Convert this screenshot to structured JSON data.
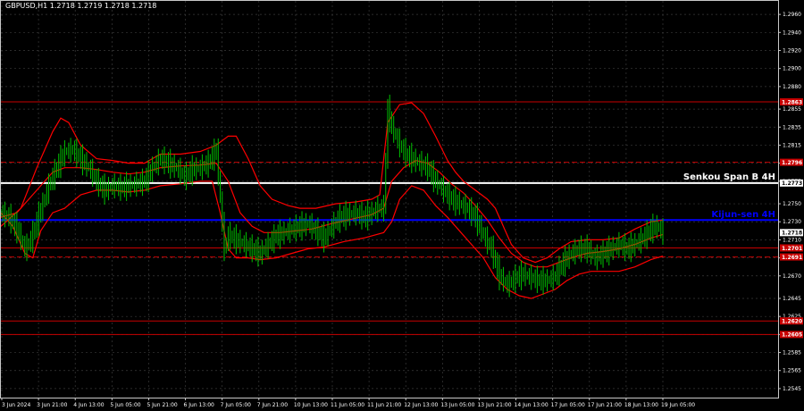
{
  "symbol_info": "GBPUSD,H1  1.2718 1.2719 1.2718 1.2718",
  "colors": {
    "background": "#000000",
    "grid": "#3a3a3a",
    "frame": "#c8c8c8",
    "candle": "#00c000",
    "indicator": "#ff0000",
    "level_line": "#c80000",
    "senkou_line": "#ffffff",
    "kijun_line": "#0000ff",
    "text": "#ffffff"
  },
  "chart_data": {
    "type": "line",
    "title": "GBPUSD,H1  1.2718 1.2719 1.2718 1.2718",
    "ylim": [
      1.2535,
      1.2975
    ],
    "y_ticks": [
      "1.2960",
      "1.2940",
      "1.2920",
      "1.2900",
      "1.2880",
      "1.2855",
      "1.2835",
      "1.2815",
      "1.2795",
      "1.2775",
      "1.2750",
      "1.2730",
      "1.2710",
      "1.2690",
      "1.2670",
      "1.2645",
      "1.2625",
      "1.2605",
      "1.2585",
      "1.2565",
      "1.2545"
    ],
    "x_ticks": [
      "3 Jun 2024",
      "3 Jun 21:00",
      "4 Jun 13:00",
      "5 Jun 05:00",
      "5 Jun 21:00",
      "6 Jun 13:00",
      "7 Jun 05:00",
      "7 Jun 21:00",
      "10 Jun 13:00",
      "11 Jun 05:00",
      "11 Jun 21:00",
      "12 Jun 13:00",
      "13 Jun 05:00",
      "13 Jun 21:00",
      "14 Jun 13:00",
      "17 Jun 05:00",
      "17 Jun 21:00",
      "18 Jun 13:00",
      "19 Jun 05:00"
    ],
    "price_path": [
      [
        0,
        1.274
      ],
      [
        4,
        1.2735
      ],
      [
        8,
        1.2722
      ],
      [
        12,
        1.27
      ],
      [
        15,
        1.271
      ],
      [
        18,
        1.273
      ],
      [
        21,
        1.275
      ],
      [
        24,
        1.277
      ],
      [
        28,
        1.279
      ],
      [
        32,
        1.2808
      ],
      [
        36,
        1.281
      ],
      [
        40,
        1.28
      ],
      [
        44,
        1.279
      ],
      [
        48,
        1.2775
      ],
      [
        52,
        1.2765
      ],
      [
        56,
        1.277
      ],
      [
        60,
        1.2768
      ],
      [
        64,
        1.277
      ],
      [
        68,
        1.2772
      ],
      [
        72,
        1.2775
      ],
      [
        76,
        1.279
      ],
      [
        80,
        1.28
      ],
      [
        84,
        1.2795
      ],
      [
        88,
        1.279
      ],
      [
        92,
        1.278
      ],
      [
        96,
        1.2788
      ],
      [
        100,
        1.279
      ],
      [
        104,
        1.2795
      ],
      [
        108,
        1.281
      ],
      [
        112,
        1.27
      ],
      [
        114,
        1.2715
      ],
      [
        118,
        1.271
      ],
      [
        122,
        1.2705
      ],
      [
        126,
        1.27
      ],
      [
        130,
        1.2695
      ],
      [
        134,
        1.2705
      ],
      [
        138,
        1.2715
      ],
      [
        142,
        1.2718
      ],
      [
        146,
        1.2722
      ],
      [
        150,
        1.2725
      ],
      [
        154,
        1.2728
      ],
      [
        158,
        1.272
      ],
      [
        162,
        1.2712
      ],
      [
        166,
        1.2725
      ],
      [
        170,
        1.2735
      ],
      [
        174,
        1.2738
      ],
      [
        178,
        1.274
      ],
      [
        182,
        1.2735
      ],
      [
        186,
        1.274
      ],
      [
        189,
        1.2745
      ],
      [
        192,
        1.2745
      ],
      [
        194,
        1.2855
      ],
      [
        196,
        1.2835
      ],
      [
        198,
        1.2825
      ],
      [
        200,
        1.2815
      ],
      [
        203,
        1.2805
      ],
      [
        206,
        1.28
      ],
      [
        210,
        1.2795
      ],
      [
        214,
        1.279
      ],
      [
        218,
        1.2775
      ],
      [
        222,
        1.2765
      ],
      [
        226,
        1.2755
      ],
      [
        230,
        1.275
      ],
      [
        234,
        1.2745
      ],
      [
        238,
        1.2735
      ],
      [
        242,
        1.2715
      ],
      [
        246,
        1.27
      ],
      [
        250,
        1.267
      ],
      [
        254,
        1.266
      ],
      [
        258,
        1.2668
      ],
      [
        262,
        1.2672
      ],
      [
        266,
        1.2668
      ],
      [
        270,
        1.2665
      ],
      [
        274,
        1.2665
      ],
      [
        278,
        1.267
      ],
      [
        282,
        1.2685
      ],
      [
        286,
        1.2695
      ],
      [
        290,
        1.27
      ],
      [
        294,
        1.27
      ],
      [
        298,
        1.269
      ],
      [
        302,
        1.2695
      ],
      [
        306,
        1.27
      ],
      [
        310,
        1.2705
      ],
      [
        314,
        1.27
      ],
      [
        318,
        1.2705
      ],
      [
        322,
        1.2712
      ],
      [
        326,
        1.2722
      ],
      [
        329,
        1.2725
      ],
      [
        332,
        1.2718
      ]
    ],
    "indicator_lines": [
      {
        "name": "upper_band",
        "points": [
          [
            0,
            1.2725
          ],
          [
            10,
            1.2745
          ],
          [
            18,
            1.279
          ],
          [
            26,
            1.283
          ],
          [
            30,
            1.2845
          ],
          [
            34,
            1.284
          ],
          [
            40,
            1.2815
          ],
          [
            48,
            1.28
          ],
          [
            56,
            1.2798
          ],
          [
            64,
            1.2795
          ],
          [
            72,
            1.2795
          ],
          [
            80,
            1.2805
          ],
          [
            90,
            1.2805
          ],
          [
            100,
            1.2808
          ],
          [
            108,
            1.2815
          ],
          [
            114,
            1.2825
          ],
          [
            118,
            1.2825
          ],
          [
            124,
            1.28
          ],
          [
            130,
            1.277
          ],
          [
            136,
            1.2755
          ],
          [
            144,
            1.2748
          ],
          [
            150,
            1.2745
          ],
          [
            158,
            1.2745
          ],
          [
            168,
            1.275
          ],
          [
            178,
            1.2752
          ],
          [
            186,
            1.2755
          ],
          [
            190,
            1.276
          ],
          [
            194,
            1.284
          ],
          [
            200,
            1.286
          ],
          [
            206,
            1.2862
          ],
          [
            212,
            1.285
          ],
          [
            218,
            1.2825
          ],
          [
            224,
            1.2798
          ],
          [
            228,
            1.2785
          ],
          [
            232,
            1.2775
          ],
          [
            238,
            1.2765
          ],
          [
            244,
            1.2755
          ],
          [
            248,
            1.2745
          ],
          [
            252,
            1.2725
          ],
          [
            256,
            1.2705
          ],
          [
            262,
            1.269
          ],
          [
            268,
            1.2685
          ],
          [
            274,
            1.269
          ],
          [
            280,
            1.27
          ],
          [
            286,
            1.2708
          ],
          [
            294,
            1.271
          ],
          [
            302,
            1.271
          ],
          [
            310,
            1.2712
          ],
          [
            318,
            1.2722
          ],
          [
            326,
            1.273
          ],
          [
            332,
            1.2732
          ]
        ]
      },
      {
        "name": "middle_band",
        "points": [
          [
            0,
            1.2735
          ],
          [
            8,
            1.274
          ],
          [
            14,
            1.2755
          ],
          [
            20,
            1.277
          ],
          [
            26,
            1.2785
          ],
          [
            32,
            1.279
          ],
          [
            40,
            1.279
          ],
          [
            48,
            1.2788
          ],
          [
            56,
            1.2785
          ],
          [
            64,
            1.2783
          ],
          [
            72,
            1.2785
          ],
          [
            80,
            1.279
          ],
          [
            90,
            1.2792
          ],
          [
            100,
            1.2793
          ],
          [
            108,
            1.2795
          ],
          [
            114,
            1.2775
          ],
          [
            120,
            1.274
          ],
          [
            126,
            1.2725
          ],
          [
            132,
            1.2718
          ],
          [
            140,
            1.2718
          ],
          [
            148,
            1.272
          ],
          [
            156,
            1.2722
          ],
          [
            166,
            1.2728
          ],
          [
            176,
            1.2733
          ],
          [
            186,
            1.2738
          ],
          [
            192,
            1.2745
          ],
          [
            196,
            1.2775
          ],
          [
            202,
            1.279
          ],
          [
            208,
            1.2798
          ],
          [
            214,
            1.2795
          ],
          [
            220,
            1.2785
          ],
          [
            226,
            1.2772
          ],
          [
            232,
            1.2762
          ],
          [
            238,
            1.2748
          ],
          [
            244,
            1.2732
          ],
          [
            250,
            1.2712
          ],
          [
            256,
            1.2695
          ],
          [
            262,
            1.2685
          ],
          [
            268,
            1.268
          ],
          [
            274,
            1.268
          ],
          [
            280,
            1.2685
          ],
          [
            286,
            1.269
          ],
          [
            294,
            1.2695
          ],
          [
            302,
            1.2697
          ],
          [
            310,
            1.27
          ],
          [
            318,
            1.2705
          ],
          [
            326,
            1.2712
          ],
          [
            332,
            1.2716
          ]
        ]
      },
      {
        "name": "lower_band",
        "points": [
          [
            0,
            1.274
          ],
          [
            6,
            1.2725
          ],
          [
            12,
            1.2695
          ],
          [
            16,
            1.269
          ],
          [
            20,
            1.272
          ],
          [
            26,
            1.274
          ],
          [
            32,
            1.2745
          ],
          [
            40,
            1.276
          ],
          [
            48,
            1.2765
          ],
          [
            56,
            1.2765
          ],
          [
            64,
            1.2763
          ],
          [
            72,
            1.2765
          ],
          [
            80,
            1.277
          ],
          [
            90,
            1.2772
          ],
          [
            100,
            1.2775
          ],
          [
            106,
            1.2775
          ],
          [
            110,
            1.274
          ],
          [
            114,
            1.27
          ],
          [
            118,
            1.269
          ],
          [
            124,
            1.269
          ],
          [
            130,
            1.2688
          ],
          [
            138,
            1.269
          ],
          [
            146,
            1.2695
          ],
          [
            154,
            1.27
          ],
          [
            162,
            1.2702
          ],
          [
            172,
            1.2708
          ],
          [
            182,
            1.2712
          ],
          [
            192,
            1.2718
          ],
          [
            196,
            1.273
          ],
          [
            200,
            1.2755
          ],
          [
            206,
            1.277
          ],
          [
            212,
            1.2765
          ],
          [
            218,
            1.2748
          ],
          [
            224,
            1.2735
          ],
          [
            230,
            1.272
          ],
          [
            236,
            1.2705
          ],
          [
            242,
            1.269
          ],
          [
            248,
            1.2668
          ],
          [
            254,
            1.2655
          ],
          [
            260,
            1.2648
          ],
          [
            266,
            1.2645
          ],
          [
            272,
            1.265
          ],
          [
            278,
            1.2655
          ],
          [
            284,
            1.2665
          ],
          [
            290,
            1.2672
          ],
          [
            296,
            1.2675
          ],
          [
            302,
            1.2675
          ],
          [
            310,
            1.2675
          ],
          [
            318,
            1.268
          ],
          [
            326,
            1.2688
          ],
          [
            332,
            1.2692
          ]
        ]
      }
    ],
    "horizontal_levels": [
      {
        "value": 1.2863,
        "label": "1.2863",
        "style": "solid",
        "color": "#c80000"
      },
      {
        "value": 1.2796,
        "label": "1.2796",
        "style": "dashed",
        "color": "#c80000"
      },
      {
        "value": 1.2773,
        "label": "1.2773",
        "style": "solid",
        "color": "#ffffff",
        "thick": true
      },
      {
        "value": 1.2732,
        "label": "",
        "style": "solid",
        "color": "#0000ff",
        "thick": true
      },
      {
        "value": 1.2718,
        "label": "1.2718",
        "style": "none",
        "color": "#ffffff"
      },
      {
        "value": 1.2701,
        "label": "1.2701",
        "style": "solid",
        "color": "#c80000"
      },
      {
        "value": 1.2691,
        "label": "1.2691",
        "style": "dashed",
        "color": "#c80000"
      },
      {
        "value": 1.262,
        "label": "1.2620",
        "style": "solid",
        "color": "#c80000"
      },
      {
        "value": 1.2605,
        "label": "1.2605",
        "style": "solid",
        "color": "#c80000"
      }
    ],
    "annotations": [
      {
        "text": "Senkou Span B 4H",
        "value": 1.278,
        "color": "#ffffff"
      },
      {
        "text": "Kijun-sen 4H",
        "value": 1.2738,
        "color": "#0000ff"
      }
    ],
    "grid": true
  }
}
